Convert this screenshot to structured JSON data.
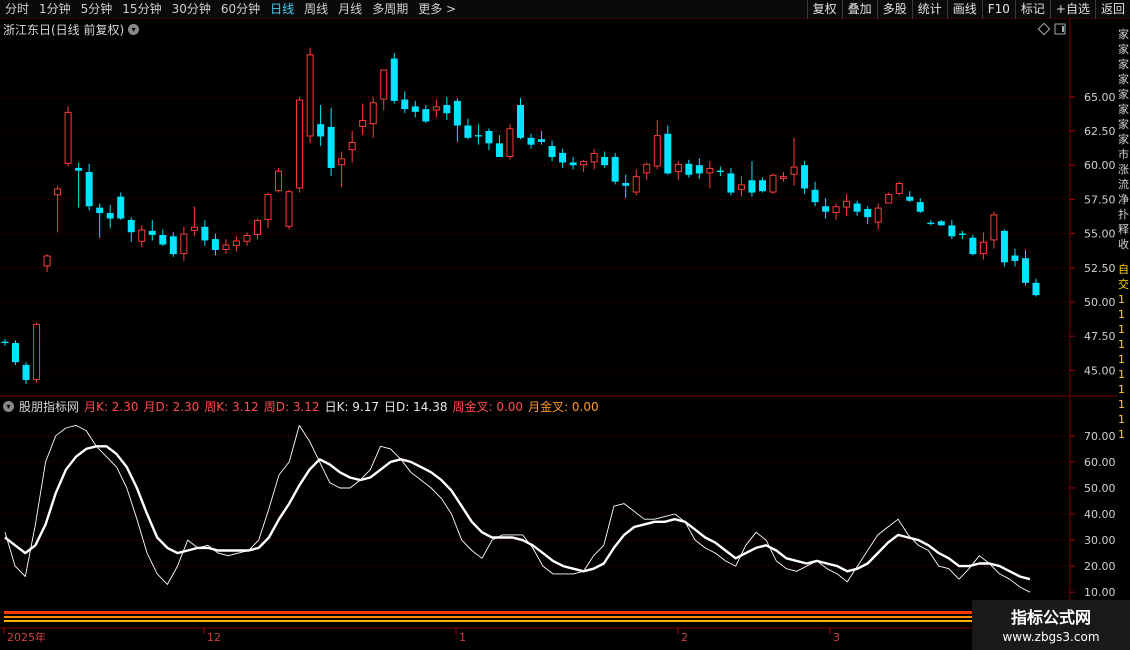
{
  "toolbar": {
    "tabs": [
      "分时",
      "1分钟",
      "5分钟",
      "15分钟",
      "30分钟",
      "60分钟",
      "日线",
      "周线",
      "月线",
      "多周期",
      "更多 >"
    ],
    "active_tab": "日线",
    "tools": [
      "复权",
      "叠加",
      "多股",
      "统计",
      "画线",
      "F10",
      "标记",
      "+自选",
      "返回"
    ]
  },
  "chart": {
    "title": "浙江东日(日线 前复权)",
    "price_ticks": [
      "65.00",
      "62.50",
      "60.00",
      "57.50",
      "55.00",
      "52.50",
      "50.00",
      "47.50",
      "45.00"
    ],
    "ind_ticks": [
      "70.00",
      "60.00",
      "50.00",
      "40.00",
      "30.00",
      "20.00",
      "10.00"
    ],
    "date_labels": [
      "2025年",
      "12",
      "1",
      "2",
      "3"
    ]
  },
  "indicator": {
    "name": "股朋指标网",
    "values": [
      {
        "label": "月K: 2.30",
        "color": "red"
      },
      {
        "label": "月D: 2.30",
        "color": "red"
      },
      {
        "label": "周K: 3.12",
        "color": "red"
      },
      {
        "label": "周D: 3.12",
        "color": "red"
      },
      {
        "label": "日K: 9.17",
        "color": "white"
      },
      {
        "label": "日D: 14.38",
        "color": "white"
      },
      {
        "label": "周金叉: 0.00",
        "color": "red"
      },
      {
        "label": "月金叉: 0.00",
        "color": "orange"
      }
    ]
  },
  "right_cut_text": "家家家家家家家家市涨流净扑释收",
  "right_cut_text2": "自交1111111111",
  "watermark": {
    "line1": "指标公式网",
    "line2": "www.zbgs3.com"
  },
  "colors": {
    "up": "#ff3b3b",
    "down": "#00e5ff",
    "active_tab": "#3fd1f7"
  },
  "chart_data": {
    "type": "candlestick",
    "candles": [
      [
        47.1,
        47.3,
        46.8,
        47.0
      ],
      [
        47.0,
        47.2,
        45.4,
        45.6
      ],
      [
        45.4,
        45.6,
        44.0,
        44.3
      ],
      [
        44.3,
        48.5,
        44.1,
        48.4
      ],
      [
        52.6,
        53.5,
        52.2,
        53.4
      ],
      [
        57.8,
        58.5,
        55.1,
        58.3
      ],
      [
        60.1,
        64.3,
        59.9,
        63.9
      ],
      [
        59.8,
        60.2,
        56.9,
        59.6
      ],
      [
        59.5,
        60.1,
        56.7,
        57.0
      ],
      [
        56.9,
        57.2,
        54.7,
        56.5
      ],
      [
        56.5,
        57.1,
        55.4,
        56.1
      ],
      [
        57.7,
        58.0,
        56.0,
        56.1
      ],
      [
        56.0,
        56.2,
        54.4,
        55.1
      ],
      [
        54.4,
        55.6,
        54.0,
        55.3
      ],
      [
        55.2,
        56.0,
        54.5,
        54.9
      ],
      [
        54.9,
        55.3,
        54.1,
        54.2
      ],
      [
        54.8,
        55.1,
        53.3,
        53.5
      ],
      [
        53.5,
        55.5,
        53.0,
        55.0
      ],
      [
        55.2,
        57.0,
        54.8,
        55.5
      ],
      [
        55.5,
        56.0,
        54.1,
        54.5
      ],
      [
        54.6,
        55.0,
        53.4,
        53.8
      ],
      [
        53.8,
        54.6,
        53.5,
        54.2
      ],
      [
        54.1,
        54.8,
        53.7,
        54.5
      ],
      [
        54.4,
        55.1,
        54.1,
        54.9
      ],
      [
        54.9,
        56.1,
        54.6,
        56.0
      ],
      [
        56.0,
        58.0,
        55.4,
        57.9
      ],
      [
        58.1,
        59.8,
        58.0,
        59.6
      ],
      [
        55.5,
        58.2,
        55.3,
        58.1
      ],
      [
        58.3,
        65.0,
        58.0,
        64.8
      ],
      [
        62.1,
        68.6,
        61.6,
        68.1
      ],
      [
        63.0,
        64.4,
        61.4,
        62.1
      ],
      [
        62.8,
        64.2,
        59.2,
        59.8
      ],
      [
        60.0,
        61.0,
        58.4,
        60.5
      ],
      [
        61.1,
        62.5,
        60.2,
        61.7
      ],
      [
        62.8,
        64.5,
        62.2,
        63.3
      ],
      [
        63.0,
        65.0,
        62.0,
        64.6
      ],
      [
        64.8,
        67.0,
        64.0,
        67.0
      ],
      [
        67.8,
        68.2,
        64.5,
        64.7
      ],
      [
        64.8,
        65.4,
        63.8,
        64.1
      ],
      [
        64.3,
        64.7,
        63.5,
        63.9
      ],
      [
        64.1,
        64.4,
        63.1,
        63.2
      ],
      [
        64.0,
        64.8,
        63.5,
        64.3
      ],
      [
        64.4,
        65.0,
        63.3,
        63.8
      ],
      [
        64.7,
        64.9,
        61.7,
        62.9
      ],
      [
        62.9,
        63.4,
        61.9,
        62.0
      ],
      [
        62.2,
        63.0,
        61.5,
        62.1
      ],
      [
        62.5,
        62.7,
        61.1,
        61.6
      ],
      [
        61.6,
        62.2,
        60.6,
        60.6
      ],
      [
        60.6,
        63.0,
        60.4,
        62.7
      ],
      [
        64.4,
        64.9,
        61.9,
        62.0
      ],
      [
        62.0,
        62.3,
        61.2,
        61.5
      ],
      [
        61.9,
        62.5,
        61.5,
        61.7
      ],
      [
        61.4,
        61.8,
        60.3,
        60.6
      ],
      [
        60.9,
        61.2,
        59.8,
        60.2
      ],
      [
        60.2,
        60.6,
        59.7,
        60.0
      ],
      [
        60.0,
        60.4,
        59.5,
        60.3
      ],
      [
        60.2,
        61.2,
        59.7,
        60.9
      ],
      [
        60.6,
        61.0,
        59.8,
        60.0
      ],
      [
        60.6,
        60.9,
        58.6,
        58.8
      ],
      [
        58.7,
        59.3,
        57.6,
        58.5
      ],
      [
        58.0,
        59.7,
        57.8,
        59.2
      ],
      [
        59.4,
        60.2,
        58.9,
        60.1
      ],
      [
        59.9,
        63.3,
        59.7,
        62.2
      ],
      [
        62.3,
        62.9,
        59.3,
        59.4
      ],
      [
        59.5,
        60.3,
        58.9,
        60.1
      ],
      [
        60.1,
        60.4,
        59.1,
        59.3
      ],
      [
        60.0,
        60.5,
        59.0,
        59.4
      ],
      [
        59.4,
        60.3,
        58.3,
        59.8
      ],
      [
        59.6,
        59.9,
        59.2,
        59.5
      ],
      [
        59.4,
        59.8,
        57.8,
        58.0
      ],
      [
        58.2,
        59.2,
        57.7,
        58.6
      ],
      [
        58.9,
        60.3,
        57.7,
        58.0
      ],
      [
        58.9,
        59.1,
        58.0,
        58.1
      ],
      [
        58.0,
        59.4,
        57.9,
        59.3
      ],
      [
        59.0,
        59.5,
        58.8,
        59.2
      ],
      [
        59.3,
        62.0,
        58.5,
        59.9
      ],
      [
        60.0,
        60.3,
        57.9,
        58.3
      ],
      [
        58.2,
        58.8,
        57.0,
        57.3
      ],
      [
        57.0,
        57.6,
        56.1,
        56.6
      ],
      [
        56.5,
        57.2,
        56.0,
        57.0
      ],
      [
        56.9,
        57.9,
        56.3,
        57.4
      ],
      [
        57.2,
        57.4,
        56.3,
        56.6
      ],
      [
        56.8,
        57.0,
        55.7,
        56.2
      ],
      [
        55.8,
        57.2,
        55.3,
        56.9
      ],
      [
        57.2,
        58.0,
        57.2,
        57.9
      ],
      [
        57.9,
        58.8,
        57.8,
        58.7
      ],
      [
        57.7,
        58.1,
        57.3,
        57.4
      ],
      [
        57.3,
        57.6,
        56.5,
        56.6
      ],
      [
        55.8,
        56.0,
        55.6,
        55.7
      ],
      [
        55.9,
        56.0,
        55.6,
        55.6
      ],
      [
        55.6,
        56.0,
        54.6,
        54.8
      ],
      [
        55.0,
        55.2,
        54.6,
        54.9
      ],
      [
        54.7,
        54.9,
        53.4,
        53.5
      ],
      [
        53.5,
        55.1,
        53.1,
        54.4
      ],
      [
        54.5,
        56.6,
        53.9,
        56.4
      ],
      [
        55.2,
        55.3,
        52.6,
        52.9
      ],
      [
        53.4,
        53.9,
        52.6,
        53.0
      ],
      [
        53.2,
        53.8,
        51.2,
        51.4
      ],
      [
        51.4,
        51.7,
        50.4,
        50.5
      ]
    ],
    "indicator_series": [
      {
        "values": [
          33,
          20,
          16,
          36,
          60,
          70,
          73,
          74,
          72,
          66,
          62,
          58,
          50,
          38,
          25,
          17,
          13,
          20,
          30,
          27,
          28,
          25,
          24,
          25,
          26,
          30,
          42,
          55,
          60,
          74,
          68,
          60,
          52,
          50,
          50,
          53,
          57,
          66,
          65,
          61,
          56,
          53,
          50,
          46,
          40,
          30,
          26,
          23,
          30,
          32,
          32,
          32,
          27,
          20,
          17,
          17,
          17,
          18,
          24,
          28,
          43,
          44,
          41,
          38,
          38,
          39,
          40,
          37,
          30,
          27,
          25,
          22,
          20,
          28,
          33,
          30,
          22,
          19,
          18,
          20,
          22,
          19,
          17,
          14,
          20,
          26,
          32,
          35,
          38,
          32,
          28,
          26,
          20,
          19,
          15,
          19,
          24,
          21,
          17,
          15,
          12,
          10
        ]
      },
      {
        "values": [
          31,
          28,
          25,
          28,
          36,
          48,
          57,
          62,
          65,
          66,
          66,
          63,
          58,
          50,
          40,
          31,
          27,
          25,
          26,
          27,
          27,
          26,
          26,
          26,
          26,
          27,
          31,
          38,
          44,
          51,
          57,
          61,
          59,
          56,
          54,
          53,
          54,
          57,
          60,
          61,
          60,
          58,
          56,
          53,
          49,
          43,
          37,
          33,
          31,
          31,
          31,
          30,
          28,
          25,
          22,
          20,
          19,
          18,
          19,
          21,
          27,
          32,
          35,
          36,
          37,
          37,
          38,
          37,
          34,
          31,
          29,
          26,
          23,
          25,
          27,
          28,
          26,
          23,
          22,
          21,
          22,
          21,
          20,
          18,
          19,
          21,
          25,
          29,
          32,
          31,
          30,
          28,
          25,
          23,
          20,
          20,
          21,
          21,
          20,
          18,
          16,
          15
        ]
      }
    ]
  }
}
